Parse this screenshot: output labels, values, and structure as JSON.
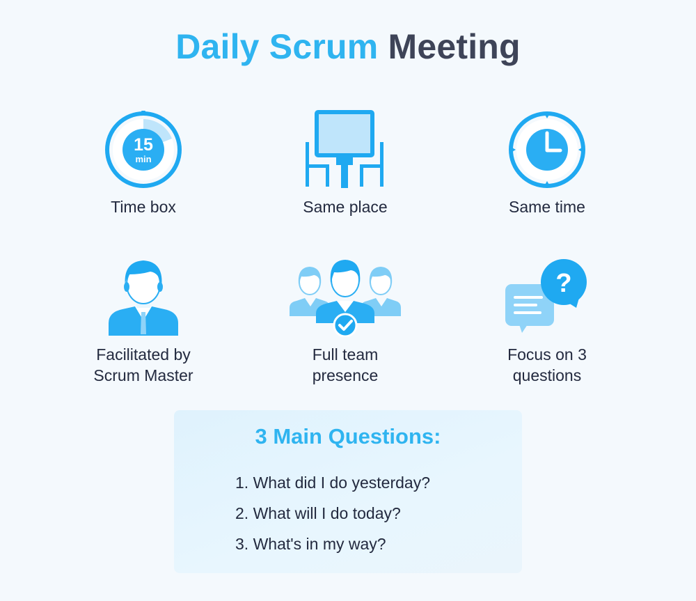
{
  "title": {
    "part1": "Daily Scrum",
    "part2": "Meeting"
  },
  "items": [
    {
      "label_lines": [
        "Time box"
      ],
      "icon": "stopwatch-icon",
      "timer": {
        "number": "15",
        "unit": "min"
      }
    },
    {
      "label_lines": [
        "Same place"
      ],
      "icon": "meeting-table-icon"
    },
    {
      "label_lines": [
        "Same time"
      ],
      "icon": "clock-icon"
    },
    {
      "label_lines": [
        "Facilitated by",
        "Scrum Master"
      ],
      "icon": "person-icon"
    },
    {
      "label_lines": [
        "Full team",
        "presence"
      ],
      "icon": "team-icon"
    },
    {
      "label_lines": [
        "Focus on 3",
        "questions"
      ],
      "icon": "chat-bubbles-icon",
      "bubble_glyph": "?"
    }
  ],
  "questions": {
    "title": "3 Main Questions:",
    "list": [
      "1. What did I do yesterday?",
      "2. What will I do today?",
      "3. What's in my way?"
    ]
  },
  "colors": {
    "accent": "#2fb4f0",
    "title_dark": "#3e4458",
    "text": "#232a3f",
    "icon_blue": "#1fa9f1",
    "icon_light": "#bfe5fb",
    "background": "#f4f9fd"
  }
}
